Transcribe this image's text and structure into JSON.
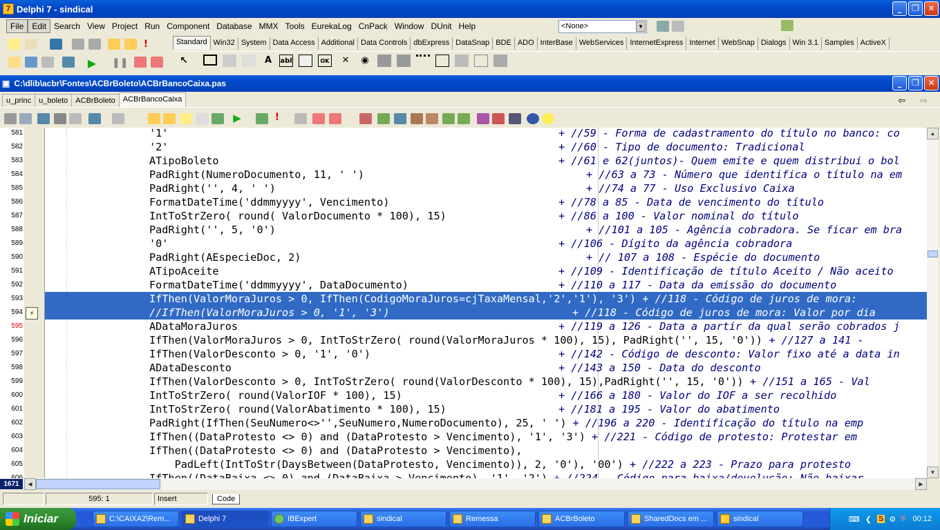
{
  "window": {
    "title": "Delphi 7 - sindical"
  },
  "menu": [
    "File",
    "Edit",
    "Search",
    "View",
    "Project",
    "Run",
    "Component",
    "Database",
    "MMX",
    "Tools",
    "EurekaLog",
    "CnPack",
    "Window",
    "DUnit",
    "Help"
  ],
  "combo_value": "<None>",
  "palette_tabs": [
    "Standard",
    "Win32",
    "System",
    "Data Access",
    "Additional",
    "Data Controls",
    "dbExpress",
    "DataSnap",
    "BDE",
    "ADO",
    "InterBase",
    "WebServices",
    "InternetExpress",
    "Internet",
    "WebSnap",
    "Dialogs",
    "Win 3.1",
    "Samples",
    "ActiveX"
  ],
  "palette_glyphs": [
    "A",
    "abl",
    "OK",
    "✕",
    "◉"
  ],
  "editor": {
    "title": "C:\\dlib\\acbr\\Fontes\\ACBrBoleto\\ACBrBancoCaixa.pas",
    "tabs": [
      "u_princ",
      "u_boleto",
      "ACBrBoleto",
      "ACBrBancoCaixa"
    ]
  },
  "code_lines": [
    {
      "num": "581",
      "code": "'1'",
      "cmt": "+ //59 - Forma de cadastramento do título no banco: co",
      "pad": 592
    },
    {
      "num": "582",
      "code": "'2'",
      "cmt": "+ //60 - Tipo de documento: Tradicional",
      "pad": 592
    },
    {
      "num": "583",
      "code": "ATipoBoleto",
      "cmt": "+ //61 e 62(juntos)- Quem emite e quem distribui o bol",
      "pad": 592
    },
    {
      "num": "584",
      "code": "PadRight(NumeroDocumento, 11, ' ')",
      "cmt": "+ //63 a 73 - Número que identifica o título na em",
      "pad": 632
    },
    {
      "num": "585",
      "code": "PadRight('', 4, ' ')",
      "cmt": "+ //74 a 77 - Uso Exclusivo Caixa",
      "pad": 632
    },
    {
      "num": "586",
      "code": "FormatDateTime('ddmmyyyy', Vencimento)",
      "cmt": "+ //78 a 85 - Data de vencimento do título",
      "pad": 592
    },
    {
      "num": "587",
      "code": "IntToStrZero( round( ValorDocumento * 100), 15)",
      "cmt": "+ //86 a 100 - Valor nominal do título",
      "pad": 592
    },
    {
      "num": "588",
      "code": "PadRight('', 5, '0')",
      "cmt": "+ //101 a 105 - Agência cobradora. Se ficar em bra",
      "pad": 632
    },
    {
      "num": "589",
      "code": "'0'",
      "cmt": "+ //106 - Dígito da agência cobradora",
      "pad": 592
    },
    {
      "num": "590",
      "code": "PadRight(AEspecieDoc, 2)",
      "cmt": "+ // 107 a 108 - Espécie do documento",
      "pad": 632
    },
    {
      "num": "591",
      "code": "ATipoAceite",
      "cmt": "+ //109 - Identificação de título Aceito / Não aceito",
      "pad": 592
    },
    {
      "num": "592",
      "code": "FormatDateTime('ddmmyyyy', DataDocumento)",
      "cmt": "+ //110 a 117 - Data da emissão do documento",
      "pad": 592
    },
    {
      "num": "593",
      "code": "IfThen(ValorMoraJuros > 0, IfThen(CodigoMoraJuros=cjTaxaMensal,'2','1'), '3')",
      "cmt": "+ //118 - Código de juros de mora:",
      "pad": 0,
      "sel": true
    },
    {
      "num": "594",
      "code": "//IfThen(ValorMoraJuros > 0, '1', '3')",
      "cmt": "+ //118 - Código de juros de mora: Valor por dia",
      "pad": 612,
      "sel": true
    },
    {
      "num": "595",
      "code": "ADataMoraJuros",
      "cmt": "+ //119 a 126 - Data a partir da qual serão cobrados j",
      "pad": 592,
      "err": true
    },
    {
      "num": "596",
      "code": "IfThen(ValorMoraJuros > 0, IntToStrZero( round(ValorMoraJuros * 100), 15), PadRight('', 15, '0'))",
      "cmt": "+ //127 a 141 -",
      "pad": 0
    },
    {
      "num": "597",
      "code": "IfThen(ValorDesconto > 0, '1', '0')",
      "cmt": "+ //142 - Código de desconto: Valor fixo até a data in",
      "pad": 592
    },
    {
      "num": "598",
      "code": "ADataDesconto",
      "cmt": "+ //143 a 150 - Data do desconto",
      "pad": 592
    },
    {
      "num": "599",
      "code": "IfThen(ValorDesconto > 0, IntToStrZero( round(ValorDesconto * 100), 15),PadRight('', 15, '0'))",
      "cmt": "+ //151 a 165 - Val",
      "pad": 0
    },
    {
      "num": "600",
      "code": "IntToStrZero( round(ValorIOF * 100), 15)",
      "cmt": "+ //166 a 180 - Valor do IOF a ser recolhido",
      "pad": 592
    },
    {
      "num": "601",
      "code": "IntToStrZero( round(ValorAbatimento * 100), 15)",
      "cmt": "+ //181 a 195 - Valor do abatimento",
      "pad": 592
    },
    {
      "num": "602",
      "code": "PadRight(IfThen(SeuNumero<>'',SeuNumero,NumeroDocumento), 25, ' ')",
      "cmt": "+ //196 a 220 - Identificação do título na emp",
      "pad": 0
    },
    {
      "num": "603",
      "code": "IfThen((DataProtesto <> 0) and (DataProtesto > Vencimento), '1', '3')",
      "cmt": "+ //221 - Código de protesto: Protestar em",
      "pad": 0
    },
    {
      "num": "604",
      "code": "IfThen((DataProtesto <> 0) and (DataProtesto > Vencimento),",
      "cmt": "",
      "pad": 0
    },
    {
      "num": "605",
      "code": "    PadLeft(IntToStr(DaysBetween(DataProtesto, Vencimento)), 2, '0'), '00')",
      "cmt": "+ //222 a 223 - Prazo para protesto",
      "pad": 0
    },
    {
      "num": "606",
      "code": "IfThen((DataBaixa <> 0) and (DataBaixa > Vencimento), '1', '2')",
      "cmt": "+ //224 - Código para baixa/devolução: Não baixar",
      "pad": 0
    }
  ],
  "hscroll_badge": "1671",
  "status": {
    "position": "595:  1",
    "mode": "Insert",
    "tab": "Code"
  },
  "taskbar": {
    "start": "Iniciar",
    "items": [
      "C:\\CAIXA2\\Rem...",
      "Delphi 7",
      "IBExpert",
      "sindical",
      "Remessa",
      "ACBrBoleto",
      "SharedDocs em ...",
      "sindical"
    ],
    "clock": "00:12"
  }
}
